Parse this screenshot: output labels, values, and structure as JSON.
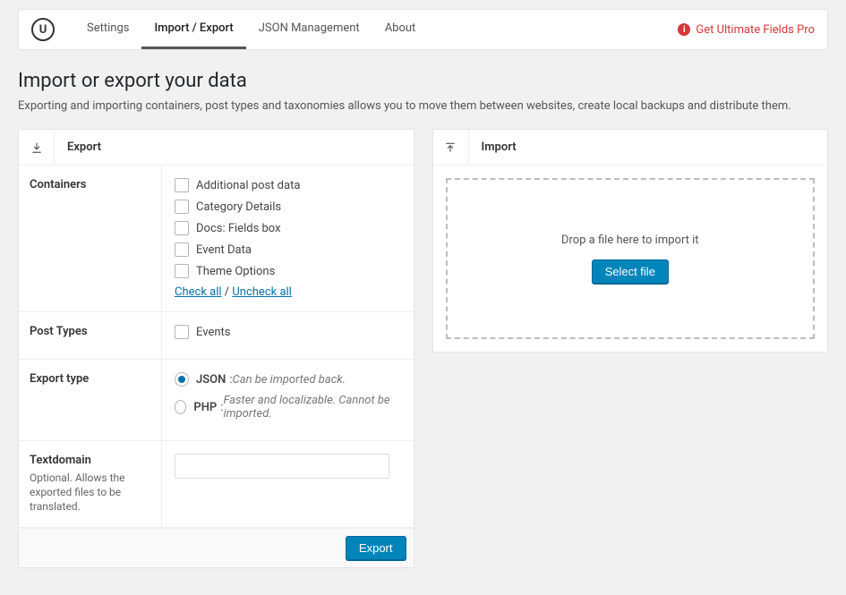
{
  "topbar": {
    "tabs": [
      {
        "label": "Settings"
      },
      {
        "label": "Import / Export"
      },
      {
        "label": "JSON Management"
      },
      {
        "label": "About"
      }
    ],
    "active_tab_index": 1,
    "pro_link": "Get Ultimate Fields Pro"
  },
  "page": {
    "title": "Import or export your data",
    "description": "Exporting and importing containers, post types and taxonomies allows you to move them between websites, create local backups and distribute them."
  },
  "export": {
    "panel_title": "Export",
    "containers": {
      "label": "Containers",
      "items": [
        "Additional post data",
        "Category Details",
        "Docs: Fields box",
        "Event Data",
        "Theme Options"
      ],
      "check_all_label": "Check all",
      "uncheck_all_label": "Uncheck all",
      "separator": " / "
    },
    "post_types": {
      "label": "Post Types",
      "items": [
        "Events"
      ]
    },
    "export_type": {
      "label": "Export type",
      "options": [
        {
          "name": "JSON",
          "note": "Can be imported back.",
          "selected": true
        },
        {
          "name": "PHP",
          "note": "Faster and localizable. Cannot be imported.",
          "selected": false
        }
      ]
    },
    "textdomain": {
      "label": "Textdomain",
      "sublabel": "Optional. Allows the exported files to be translated.",
      "value": ""
    },
    "button": "Export"
  },
  "import": {
    "panel_title": "Import",
    "drop_text": "Drop a file here to import it",
    "button": "Select file"
  }
}
